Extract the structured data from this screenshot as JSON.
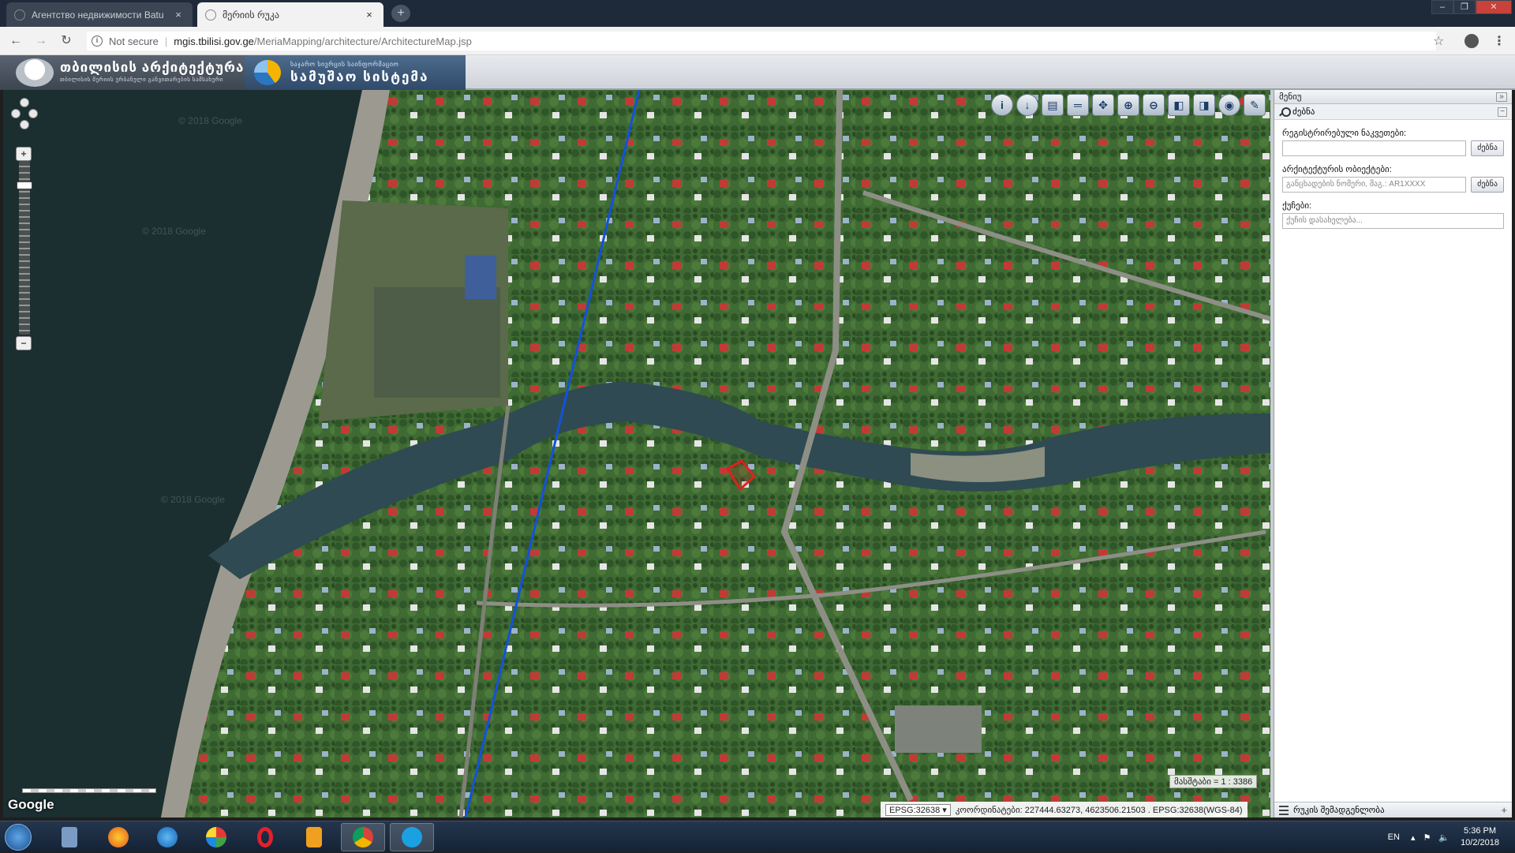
{
  "browser": {
    "tabs": [
      {
        "title": "Агентство недвижимости Batu",
        "close": "×",
        "active": false
      },
      {
        "title": "მერიის რუკა",
        "close": "×",
        "active": true
      }
    ],
    "new_tab": "+",
    "security_label": "Not secure",
    "url_host": "mgis.tbilisi.gov.ge",
    "url_path": "/MeriaMapping/architecture/ArchitectureMap.jsp"
  },
  "header": {
    "logo_title": "თბილისის არქიტექტურა",
    "logo_subtitle": "თბილისის მერიის ურბანული განვითარების სამსახური",
    "logo2_top": "საჯარო სივრცის საინფორმაციო",
    "logo2_title": "სამუშაო სისტემა"
  },
  "map": {
    "tools": [
      "info",
      "identify",
      "print",
      "measure",
      "pan",
      "zoom-in",
      "zoom-out",
      "zoom-prev",
      "zoom-next",
      "globe",
      "edit"
    ],
    "attribution": "Google",
    "watermark": "© 2018 Google",
    "scale": "მასშტაბი = 1 : 3386",
    "epsg_selected": "EPSG:32638",
    "coordinates": "კოორდინატები: 227444.63273, 4623506.21503 . EPSG:32638(WGS-84)"
  },
  "panel": {
    "title": "მენიუ",
    "search_section": "ძებნა",
    "cadastral_label": "რეგისტრირებული ნაკვეთები:",
    "cadastral_value": "",
    "search_button": "ძებნა",
    "object_label": "არქიტექტურის ობიექტები:",
    "object_placeholder": "განცხადების ნომერი, მაგ.: AR1XXXX",
    "street_label": "ქუჩები:",
    "street_placeholder": "ქუჩის დასახელება...",
    "footer": "რუკის შემადგენლობა"
  },
  "taskbar": {
    "language": "EN",
    "time": "5:36 PM",
    "date": "10/2/2018"
  },
  "colors": {
    "river": "#2f4a52",
    "sea": "#1b2e30",
    "vegetation": "#3f6a33",
    "route_line": "#1452d8",
    "parcel": "#e02020"
  }
}
